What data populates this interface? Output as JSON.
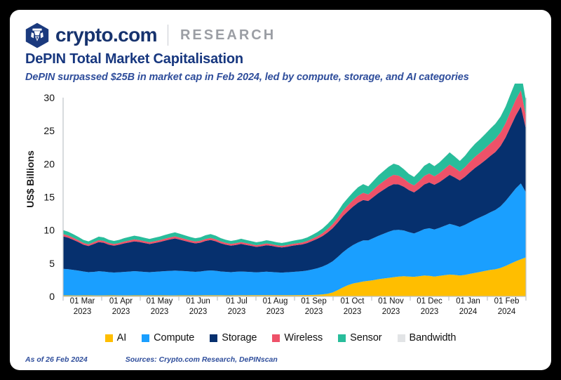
{
  "brand": {
    "logo_icon": "crypto-com-hexagon-logo",
    "wordmark": "crypto.com",
    "division": "RESEARCH"
  },
  "header": {
    "title": "DePIN Total Market Capitalisation",
    "subtitle": "DePIN surpassed $25B in market cap in Feb 2024, led by compute, storage, and AI categories"
  },
  "footer": {
    "as_of": "As of 26 Feb 2024",
    "sources": "Sources: Crypto.com Research, DePINscan"
  },
  "colors": {
    "ai": "#FFBE00",
    "compute": "#1A9FFF",
    "storage": "#06306E",
    "wireless": "#EE5269",
    "sensor": "#28BD9B",
    "bandwidth": "#E2E4E6",
    "title": "#17377F",
    "subtitle": "#2E4D9B",
    "brand_navy": "#17336E",
    "research_gray": "#9B9EA4",
    "axis": "#BFC3C7",
    "frame": "#000000"
  },
  "chart_data": {
    "type": "area",
    "stacked": true,
    "title": "DePIN Total Market Capitalisation",
    "subtitle": "DePIN surpassed $25B in market cap in Feb 2024, led by compute, storage, and AI categories",
    "xlabel": "",
    "ylabel": "US$ Billions",
    "ylim": [
      0,
      30
    ],
    "yticks": [
      0,
      5,
      10,
      15,
      20,
      25,
      30
    ],
    "grid": false,
    "legend_position": "bottom",
    "x_tick_labels": [
      {
        "line1": "01 Mar",
        "line2": "2023"
      },
      {
        "line1": "01 Apr",
        "line2": "2023"
      },
      {
        "line1": "01 May",
        "line2": "2023"
      },
      {
        "line1": "01 Jun",
        "line2": "2023"
      },
      {
        "line1": "01 Jul",
        "line2": "2023"
      },
      {
        "line1": "01 Aug",
        "line2": "2023"
      },
      {
        "line1": "01 Sep",
        "line2": "2023"
      },
      {
        "line1": "01 Oct",
        "line2": "2023"
      },
      {
        "line1": "01 Nov",
        "line2": "2023"
      },
      {
        "line1": "01 Dec",
        "line2": "2023"
      },
      {
        "line1": "01 Jan",
        "line2": "2024"
      },
      {
        "line1": "01 Feb",
        "line2": "2024"
      }
    ],
    "x_start": "2023-03-01",
    "x_end": "2024-02-26",
    "n_points": 92,
    "series": [
      {
        "name": "AI",
        "color": "#FFBE00",
        "values": [
          0.16,
          0.16,
          0.15,
          0.15,
          0.16,
          0.16,
          0.15,
          0.15,
          0.15,
          0.16,
          0.16,
          0.15,
          0.15,
          0.15,
          0.16,
          0.16,
          0.15,
          0.16,
          0.16,
          0.16,
          0.16,
          0.15,
          0.15,
          0.16,
          0.16,
          0.16,
          0.16,
          0.16,
          0.17,
          0.17,
          0.17,
          0.17,
          0.16,
          0.16,
          0.17,
          0.17,
          0.17,
          0.18,
          0.18,
          0.18,
          0.18,
          0.18,
          0.18,
          0.19,
          0.19,
          0.19,
          0.2,
          0.2,
          0.21,
          0.22,
          0.25,
          0.3,
          0.4,
          0.6,
          0.95,
          1.35,
          1.7,
          1.95,
          2.1,
          2.25,
          2.35,
          2.45,
          2.6,
          2.7,
          2.8,
          2.9,
          3.0,
          3.05,
          3.0,
          2.95,
          3.05,
          3.15,
          3.1,
          3.0,
          3.1,
          3.2,
          3.3,
          3.25,
          3.15,
          3.25,
          3.4,
          3.55,
          3.7,
          3.85,
          4.0,
          4.1,
          4.3,
          4.6,
          4.95,
          5.3,
          5.6,
          5.9
        ]
      },
      {
        "name": "Compute",
        "color": "#1A9FFF",
        "values": [
          4.0,
          3.95,
          3.85,
          3.75,
          3.6,
          3.5,
          3.55,
          3.65,
          3.6,
          3.5,
          3.45,
          3.5,
          3.55,
          3.6,
          3.65,
          3.6,
          3.55,
          3.5,
          3.55,
          3.6,
          3.65,
          3.7,
          3.75,
          3.7,
          3.65,
          3.6,
          3.55,
          3.6,
          3.7,
          3.75,
          3.7,
          3.6,
          3.55,
          3.5,
          3.55,
          3.6,
          3.55,
          3.5,
          3.45,
          3.5,
          3.55,
          3.5,
          3.45,
          3.4,
          3.45,
          3.5,
          3.55,
          3.6,
          3.7,
          3.85,
          4.0,
          4.2,
          4.45,
          4.7,
          5.0,
          5.3,
          5.55,
          5.8,
          6.05,
          6.2,
          6.1,
          6.35,
          6.55,
          6.75,
          6.95,
          7.1,
          7.05,
          6.9,
          6.7,
          6.55,
          6.75,
          7.0,
          7.2,
          7.1,
          7.25,
          7.45,
          7.65,
          7.5,
          7.35,
          7.55,
          7.8,
          8.05,
          8.25,
          8.45,
          8.7,
          8.95,
          9.3,
          9.8,
          10.4,
          11.0,
          11.45,
          9.8
        ]
      },
      {
        "name": "Storage",
        "color": "#06306E",
        "values": [
          4.9,
          4.75,
          4.55,
          4.3,
          4.05,
          3.95,
          4.2,
          4.4,
          4.35,
          4.15,
          4.05,
          4.15,
          4.3,
          4.4,
          4.5,
          4.45,
          4.35,
          4.25,
          4.35,
          4.45,
          4.6,
          4.75,
          4.85,
          4.7,
          4.55,
          4.4,
          4.3,
          4.35,
          4.5,
          4.6,
          4.45,
          4.25,
          4.1,
          4.0,
          4.05,
          4.15,
          4.05,
          3.95,
          3.85,
          3.9,
          4.0,
          3.95,
          3.85,
          3.8,
          3.85,
          3.95,
          4.0,
          4.05,
          4.15,
          4.3,
          4.45,
          4.6,
          4.8,
          5.0,
          5.2,
          5.45,
          5.6,
          5.8,
          6.0,
          6.1,
          5.95,
          6.2,
          6.45,
          6.65,
          6.85,
          6.95,
          6.85,
          6.6,
          6.35,
          6.2,
          6.45,
          6.75,
          6.9,
          6.75,
          6.9,
          7.15,
          7.4,
          7.2,
          7.0,
          7.25,
          7.55,
          7.8,
          8.0,
          8.25,
          8.5,
          8.75,
          9.1,
          9.6,
          10.3,
          11.0,
          11.6,
          9.6
        ]
      },
      {
        "name": "Wireless",
        "color": "#EE5269",
        "values": [
          0.35,
          0.33,
          0.3,
          0.28,
          0.26,
          0.25,
          0.27,
          0.29,
          0.28,
          0.26,
          0.25,
          0.26,
          0.28,
          0.29,
          0.3,
          0.29,
          0.28,
          0.27,
          0.28,
          0.29,
          0.3,
          0.31,
          0.32,
          0.31,
          0.3,
          0.29,
          0.28,
          0.29,
          0.3,
          0.31,
          0.3,
          0.28,
          0.27,
          0.26,
          0.27,
          0.28,
          0.27,
          0.26,
          0.25,
          0.26,
          0.27,
          0.26,
          0.25,
          0.25,
          0.26,
          0.27,
          0.28,
          0.29,
          0.31,
          0.34,
          0.38,
          0.44,
          0.52,
          0.6,
          0.7,
          0.82,
          0.9,
          0.98,
          1.05,
          1.08,
          1.0,
          1.1,
          1.2,
          1.28,
          1.35,
          1.4,
          1.32,
          1.2,
          1.1,
          1.05,
          1.15,
          1.28,
          1.35,
          1.28,
          1.36,
          1.45,
          1.55,
          1.45,
          1.35,
          1.45,
          1.58,
          1.68,
          1.75,
          1.82,
          1.9,
          1.98,
          2.05,
          2.15,
          2.3,
          2.4,
          2.45,
          1.95
        ]
      },
      {
        "name": "Sensor",
        "color": "#28BD9B",
        "values": [
          0.6,
          0.58,
          0.54,
          0.5,
          0.46,
          0.45,
          0.5,
          0.54,
          0.52,
          0.48,
          0.46,
          0.48,
          0.52,
          0.54,
          0.56,
          0.54,
          0.52,
          0.5,
          0.52,
          0.54,
          0.56,
          0.58,
          0.6,
          0.58,
          0.55,
          0.52,
          0.5,
          0.52,
          0.56,
          0.58,
          0.55,
          0.5,
          0.47,
          0.45,
          0.47,
          0.5,
          0.48,
          0.46,
          0.44,
          0.46,
          0.48,
          0.46,
          0.44,
          0.43,
          0.45,
          0.47,
          0.49,
          0.51,
          0.54,
          0.58,
          0.63,
          0.7,
          0.78,
          0.86,
          0.95,
          1.05,
          1.12,
          1.2,
          1.28,
          1.32,
          1.22,
          1.34,
          1.46,
          1.54,
          1.62,
          1.68,
          1.58,
          1.45,
          1.33,
          1.28,
          1.4,
          1.54,
          1.62,
          1.54,
          1.63,
          1.74,
          1.84,
          1.72,
          1.6,
          1.72,
          1.86,
          1.96,
          2.05,
          2.14,
          2.22,
          2.3,
          2.38,
          2.5,
          2.65,
          2.78,
          2.85,
          2.25
        ]
      },
      {
        "name": "Bandwidth",
        "color": "#E2E4E6",
        "values": [
          0.02,
          0.02,
          0.02,
          0.02,
          0.02,
          0.02,
          0.02,
          0.02,
          0.02,
          0.02,
          0.02,
          0.02,
          0.02,
          0.02,
          0.02,
          0.02,
          0.02,
          0.02,
          0.02,
          0.02,
          0.02,
          0.02,
          0.02,
          0.02,
          0.02,
          0.02,
          0.02,
          0.02,
          0.02,
          0.02,
          0.02,
          0.02,
          0.02,
          0.02,
          0.02,
          0.02,
          0.02,
          0.02,
          0.02,
          0.02,
          0.02,
          0.02,
          0.02,
          0.02,
          0.02,
          0.02,
          0.02,
          0.02,
          0.02,
          0.02,
          0.02,
          0.02,
          0.02,
          0.03,
          0.03,
          0.03,
          0.03,
          0.03,
          0.03,
          0.03,
          0.03,
          0.03,
          0.03,
          0.03,
          0.03,
          0.03,
          0.03,
          0.03,
          0.03,
          0.03,
          0.03,
          0.03,
          0.03,
          0.03,
          0.03,
          0.03,
          0.03,
          0.03,
          0.03,
          0.03,
          0.04,
          0.04,
          0.04,
          0.04,
          0.04,
          0.04,
          0.04,
          0.04,
          0.04,
          0.05,
          0.05,
          0.04
        ]
      }
    ]
  },
  "legend": [
    {
      "label": "AI",
      "color": "#FFBE00"
    },
    {
      "label": "Compute",
      "color": "#1A9FFF"
    },
    {
      "label": "Storage",
      "color": "#06306E"
    },
    {
      "label": "Wireless",
      "color": "#EE5269"
    },
    {
      "label": "Sensor",
      "color": "#28BD9B"
    },
    {
      "label": "Bandwidth",
      "color": "#E2E4E6"
    }
  ]
}
